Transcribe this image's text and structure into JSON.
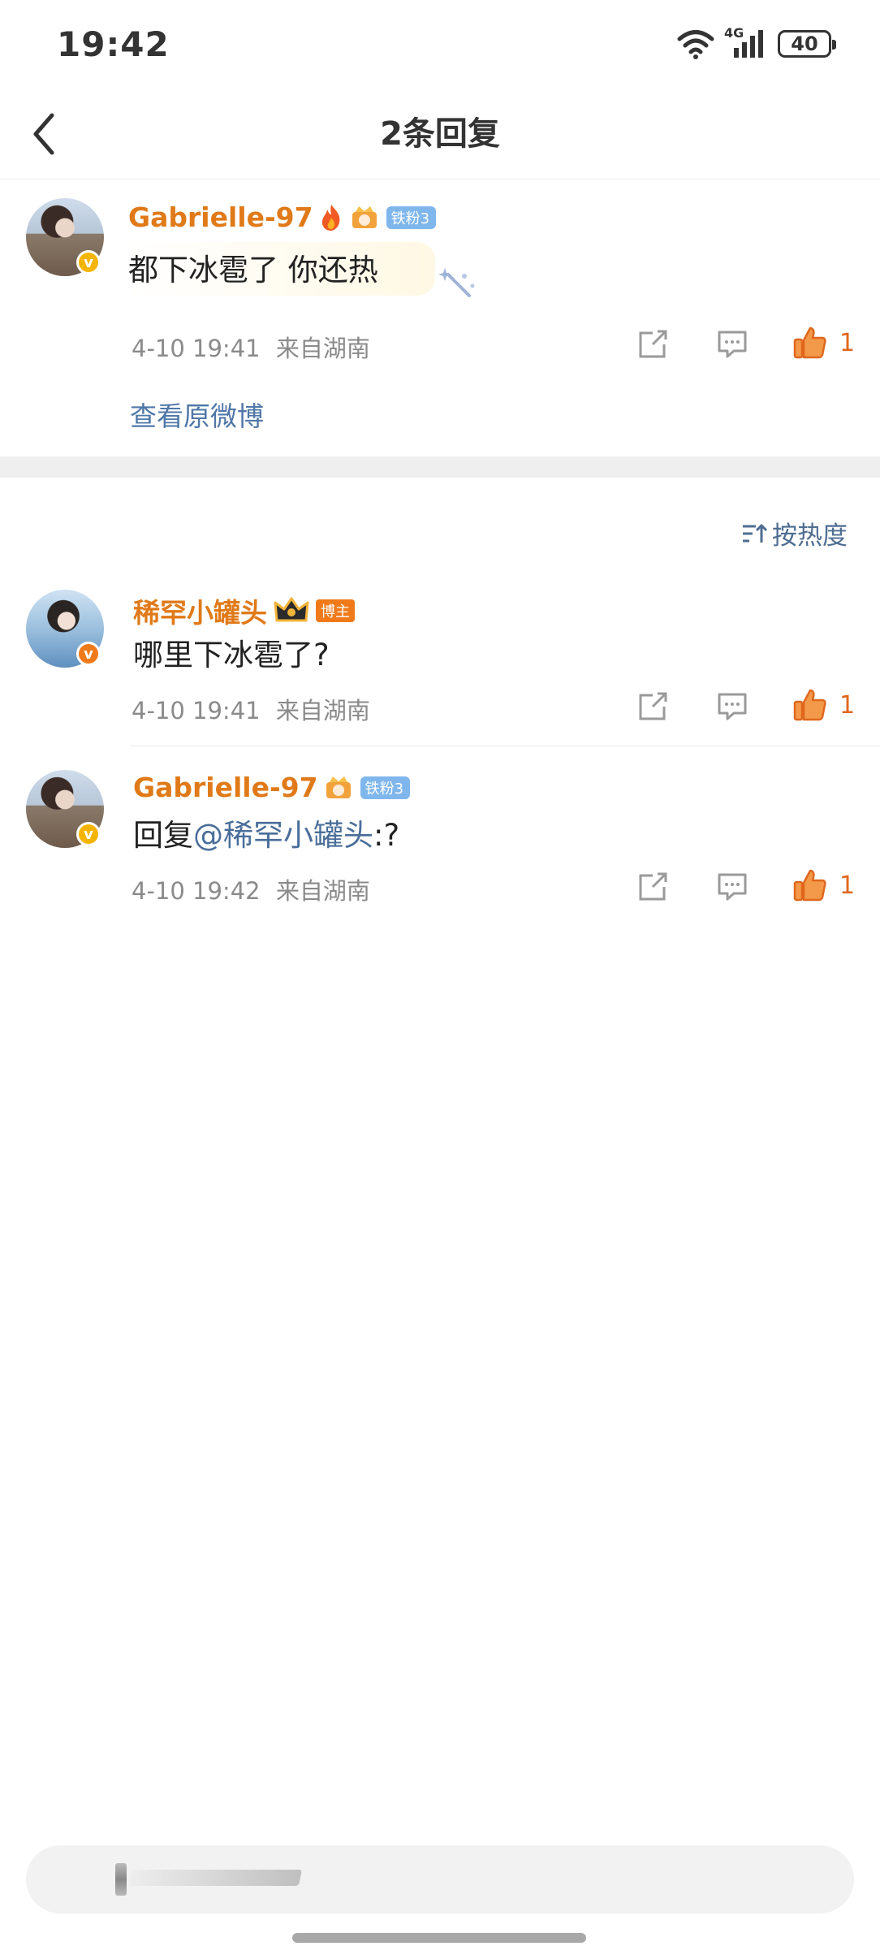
{
  "status_bar": {
    "time": "19:42",
    "network": "4G",
    "battery": "40"
  },
  "header": {
    "title": "2条回复"
  },
  "original_comment": {
    "username": "Gabrielle-97",
    "fan_badge": "铁粉3",
    "text": "都下冰雹了 你还热",
    "time": "4-10 19:41",
    "location": "来自湖南",
    "likes": "1",
    "view_original": "查看原微博"
  },
  "sort": {
    "label": "按热度"
  },
  "replies": [
    {
      "username": "稀罕小罐头",
      "badge": "博主",
      "text": "哪里下冰雹了?",
      "time": "4-10 19:41",
      "location": "来自湖南",
      "likes": "1"
    },
    {
      "username": "Gabrielle-97",
      "fan_badge": "铁粉3",
      "text_prefix": "回复",
      "mention": "@稀罕小罐头",
      "text_suffix": ":?",
      "time": "4-10 19:42",
      "location": "来自湖南",
      "likes": "1"
    }
  ],
  "colors": {
    "username": "#e07a19",
    "link": "#4f77a7",
    "like": "#e0671d",
    "fan_badge": "#7fb6ec"
  }
}
